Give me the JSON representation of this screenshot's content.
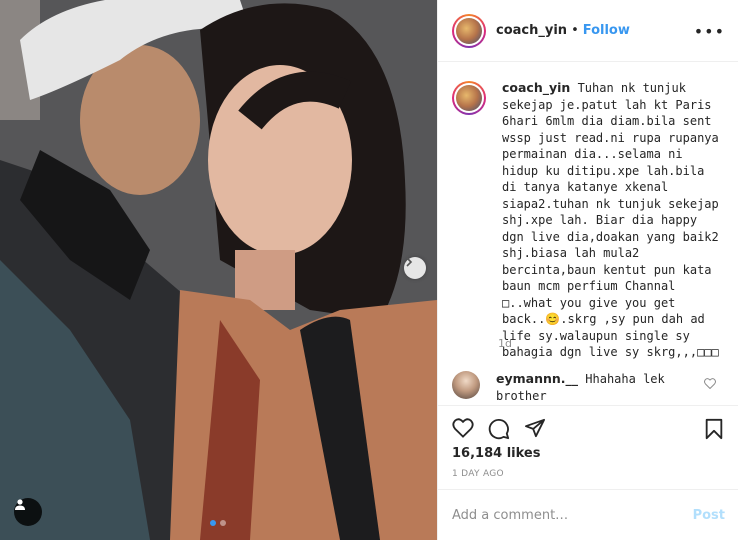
{
  "post": {
    "username": "coach_yin",
    "separator": "•",
    "follow_label": "Follow",
    "more_icon": "•••",
    "caption": "Tuhan nk tunjuk sekejap je.patut lah kt Paris 6hari 6mlm dia diam.bila sent wssp just read.ni rupa rupanya permainan dia...selama ni hidup ku ditipu.xpe lah.bila di tanya katanye xkenal siapa2.tuhan nk tunjuk sekejap shj.xpe lah. Biar dia happy dgn live dia,doakan yang baik2 shj.biasa lah mula2 bercinta,baun kentut pun kata baun mcm perfium Channal □..what you give you get back..😊.skrg ,sy pun dah ad life sy.walaupun single sy bahagia dgn live sy skrg,,,□□□",
    "caption_age": "1d",
    "likes": "16,184 likes",
    "date": "1 DAY AGO"
  },
  "comments": [
    {
      "username": "eymannn.__",
      "text": "Hhahaha lek brother"
    }
  ],
  "comment_box": {
    "placeholder": "Add a comment…",
    "post_label": "Post"
  },
  "carousel": {
    "slide_count": 2,
    "active_index": 0
  },
  "colors": {
    "link_blue": "#3897f0",
    "post_disabled": "#b2dffc",
    "muted": "#8e8e8e",
    "border": "#efefef"
  },
  "icons": [
    "heart-icon",
    "comment-icon",
    "share-icon",
    "bookmark-icon",
    "chevron-right-icon",
    "user-tag-icon",
    "more-icon"
  ]
}
